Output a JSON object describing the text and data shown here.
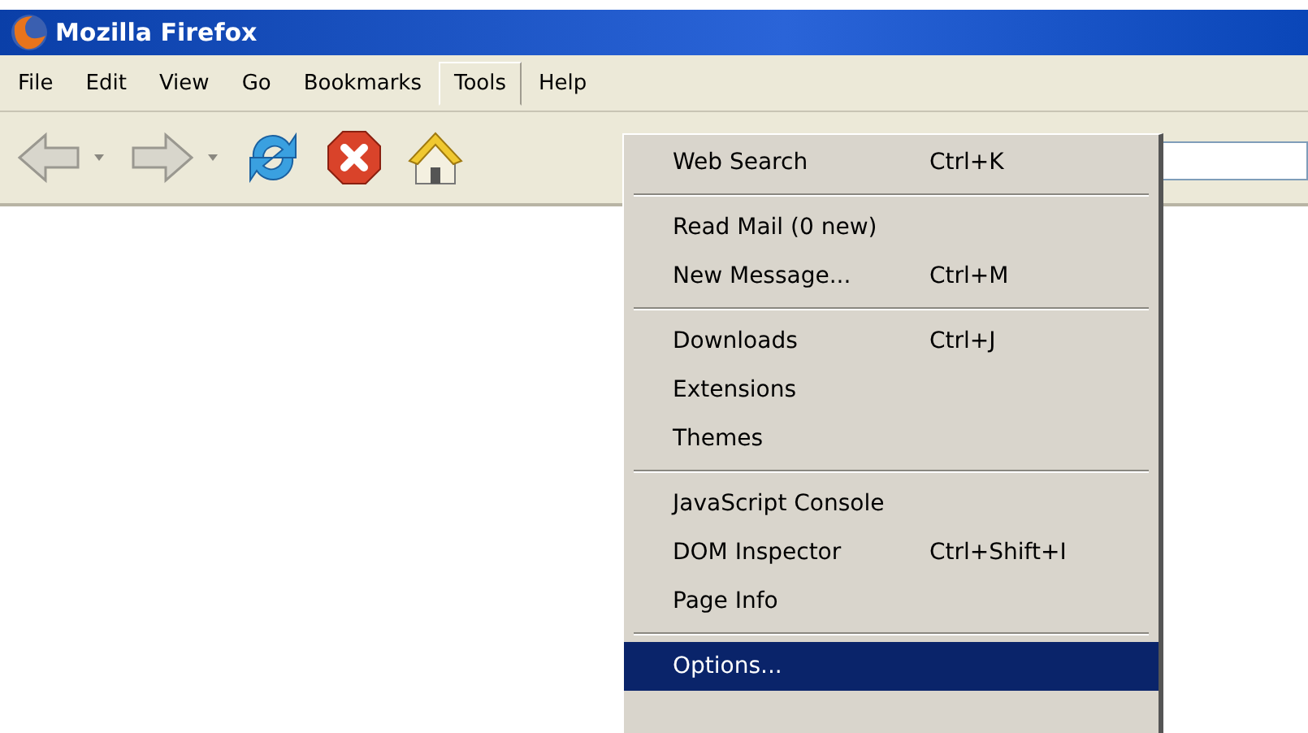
{
  "window": {
    "title": "Mozilla Firefox"
  },
  "menu_bar": [
    {
      "label": "File",
      "selected": false
    },
    {
      "label": "Edit",
      "selected": false
    },
    {
      "label": "View",
      "selected": false
    },
    {
      "label": "Go",
      "selected": false
    },
    {
      "label": "Bookmarks",
      "selected": false
    },
    {
      "label": "Tools",
      "selected": true
    },
    {
      "label": "Help",
      "selected": false
    }
  ],
  "toolbar": [
    {
      "kind": "back"
    },
    {
      "kind": "forward"
    },
    {
      "kind": "reload"
    },
    {
      "kind": "stop"
    },
    {
      "kind": "home"
    }
  ],
  "tools_menu": [
    {
      "kind": "item",
      "label": "Web Search",
      "shortcut": "Ctrl+K",
      "selected": false
    },
    {
      "kind": "separator"
    },
    {
      "kind": "item",
      "label": "Read Mail (0 new)",
      "selected": false
    },
    {
      "kind": "item",
      "label": "New Message...",
      "shortcut": "Ctrl+M",
      "selected": false
    },
    {
      "kind": "separator"
    },
    {
      "kind": "item",
      "label": "Downloads",
      "shortcut": "Ctrl+J",
      "selected": false
    },
    {
      "kind": "item",
      "label": "Extensions",
      "selected": false
    },
    {
      "kind": "item",
      "label": "Themes",
      "selected": false
    },
    {
      "kind": "separator"
    },
    {
      "kind": "item",
      "label": "JavaScript Console",
      "selected": false
    },
    {
      "kind": "item",
      "label": "DOM Inspector",
      "shortcut": "Ctrl+Shift+I",
      "selected": false
    },
    {
      "kind": "item",
      "label": "Page Info",
      "selected": false
    },
    {
      "kind": "separator"
    },
    {
      "kind": "item",
      "label": "Options...",
      "selected": true
    }
  ]
}
